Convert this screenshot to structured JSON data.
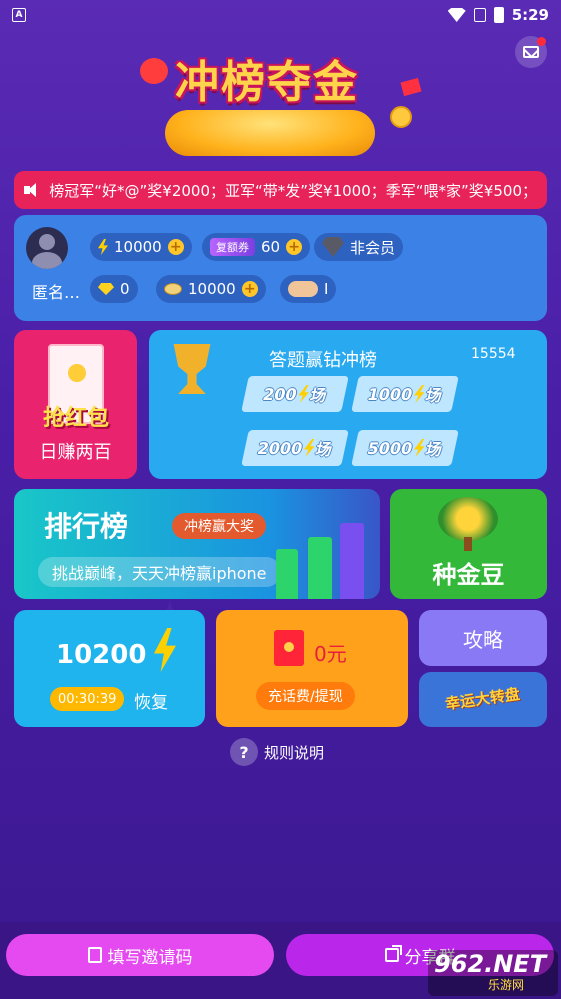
{
  "status_bar": {
    "time": "5:29",
    "app_icon": "A"
  },
  "header": {
    "title": "冲榜夺金",
    "mail_icon": "mail-icon"
  },
  "ticker": {
    "text": "榜冠军“好*@”奖¥2000；亚军“带*发”奖¥1000；季军“喂*家”奖¥500；"
  },
  "user": {
    "name": "匿名…",
    "energy": "10000",
    "ticket_label": "复额券",
    "tickets": "60",
    "member": "非会员",
    "diamonds": "0",
    "beans": "10000",
    "handshake_value": "I"
  },
  "tiles": {
    "red_packet": {
      "badge": "抢红包",
      "caption": "日赚两百"
    },
    "quiz": {
      "title": "答题赢钻冲榜",
      "count": "15554",
      "options": [
        {
          "amount": "200",
          "unit": "场"
        },
        {
          "amount": "1000",
          "unit": "场"
        },
        {
          "amount": "2000",
          "unit": "场"
        },
        {
          "amount": "5000",
          "unit": "场"
        }
      ]
    },
    "rank": {
      "title": "排行榜",
      "tag": "冲榜赢大奖",
      "subtitle": "挑战巅峰，天天冲榜赢iphone"
    },
    "bean": {
      "caption": "种金豆"
    },
    "energy": {
      "value": "10200",
      "timer": "00:30:39",
      "recover": "恢复"
    },
    "cash": {
      "amount": "0元",
      "button": "充话费/提现"
    },
    "guide": {
      "label": "攻略"
    },
    "lucky": {
      "label": "幸运大转盘"
    }
  },
  "rules": {
    "label": "规则说明",
    "icon": "?"
  },
  "bottom": {
    "invite_label": "填写邀请码",
    "share_label": "分享群"
  },
  "watermark": {
    "top": "962.NET",
    "bottom": "乐游网"
  },
  "colors": {
    "background": "#4a1fa8",
    "ticker": "#e8235a",
    "user_card": "#3c82e6",
    "quiz": "#29aaf0",
    "red_tile": "#e9236d",
    "bean_tile": "#34b83a",
    "cash_tile": "#ffa11a",
    "guide_tile": "#8a79f5"
  }
}
